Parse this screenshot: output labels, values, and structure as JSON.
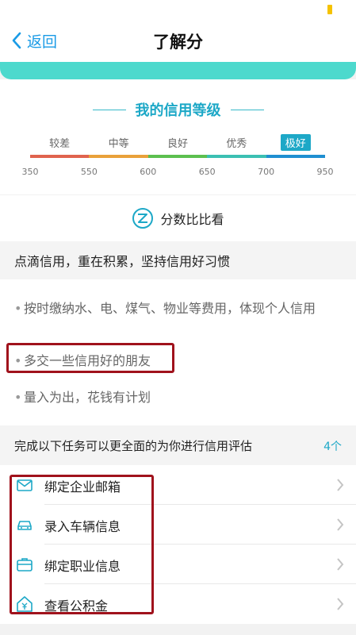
{
  "nav": {
    "back_label": "返回",
    "title": "了解分"
  },
  "level": {
    "title": "我的信用等级",
    "grades": [
      "较差",
      "中等",
      "良好",
      "优秀",
      "极好"
    ],
    "active_grade": "极好",
    "ticks": [
      "350",
      "550",
      "600",
      "650",
      "700",
      "950"
    ],
    "segment_colors": [
      "#e0634e",
      "#e9a13a",
      "#5cbf4f",
      "#3bbfb3",
      "#1f8fd1"
    ]
  },
  "compare": {
    "label": "分数比比看"
  },
  "tips": {
    "header": "点滴信用，重在积累，坚持信用好习惯",
    "items": [
      "按时缴纳水、电、煤气、物业等费用，体现个人信用",
      "多交一些信用好的朋友",
      "量入为出，花钱有计划"
    ]
  },
  "tasks": {
    "header": "完成以下任务可以更全面的为你进行信用评估",
    "count": "4个",
    "items": [
      {
        "label": "绑定企业邮箱",
        "icon": "mail-icon"
      },
      {
        "label": "录入车辆信息",
        "icon": "car-icon"
      },
      {
        "label": "绑定职业信息",
        "icon": "briefcase-icon"
      },
      {
        "label": "查看公积金",
        "icon": "house-fund-icon"
      }
    ]
  },
  "colors": {
    "accent": "#1da8c7",
    "link": "#1a9be6",
    "teal": "#4dd9cd",
    "annotation": "#a0121c"
  }
}
